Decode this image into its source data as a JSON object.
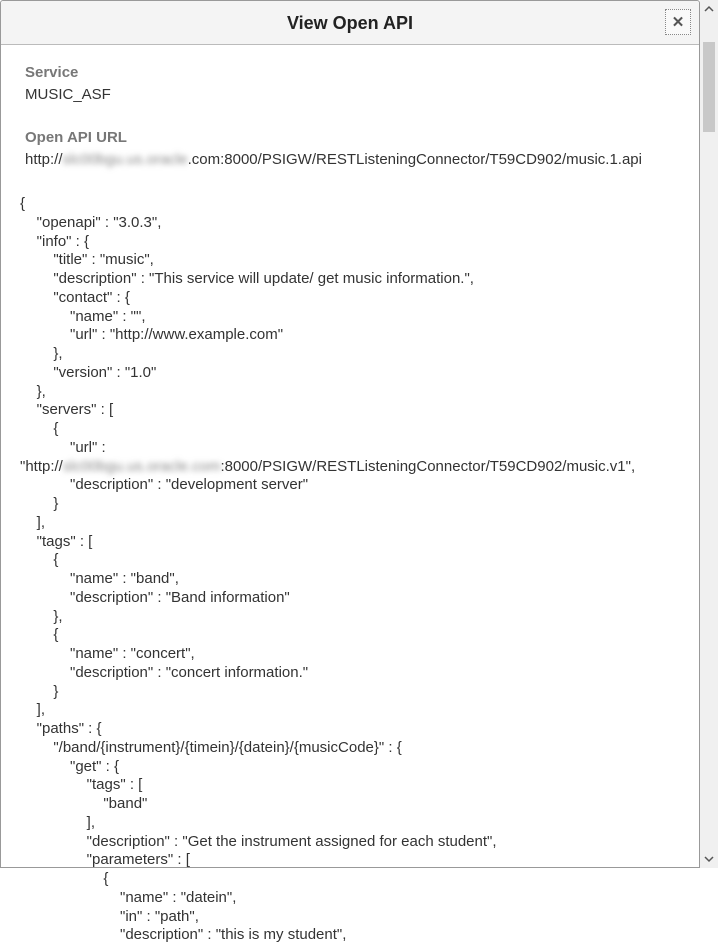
{
  "header": {
    "title": "View Open API",
    "close_glyph": "✕"
  },
  "labels": {
    "service": "Service",
    "service_value": "MUSIC_ASF",
    "openapi_url": "Open API URL",
    "url_prefix": "http://",
    "url_blurred": "slc00bgu.us.oracle",
    "url_suffix": ".com:8000/PSIGW/RESTListeningConnector/T59CD902/music.1.api"
  },
  "json_lines": {
    "l01": "{",
    "l02": "    \"openapi\" : \"3.0.3\",",
    "l03": "    \"info\" : {",
    "l04": "        \"title\" : \"music\",",
    "l05": "        \"description\" : \"This service will update/ get music information.\",",
    "l06": "        \"contact\" : {",
    "l07": "            \"name\" : \"\",",
    "l08": "            \"url\" : \"http://www.example.com\"",
    "l09": "        },",
    "l10": "        \"version\" : \"1.0\"",
    "l11": "    },",
    "l12": "    \"servers\" : [",
    "l13": "        {",
    "l14": "            \"url\" :",
    "l15a": "\"http://",
    "l15b": "slc00bgu.us.oracle.com",
    "l15c": ":8000/PSIGW/RESTListeningConnector/T59CD902/music.v1\",",
    "l16": "            \"description\" : \"development server\"",
    "l17": "        }",
    "l18": "    ],",
    "l19": "    \"tags\" : [",
    "l20": "        {",
    "l21": "            \"name\" : \"band\",",
    "l22": "            \"description\" : \"Band information\"",
    "l23": "        },",
    "l24": "        {",
    "l25": "            \"name\" : \"concert\",",
    "l26": "            \"description\" : \"concert information.\"",
    "l27": "        }",
    "l28": "    ],",
    "l29": "    \"paths\" : {",
    "l30": "        \"/band/{instrument}/{timein}/{datein}/{musicCode}\" : {",
    "l31": "            \"get\" : {",
    "l32": "                \"tags\" : [",
    "l33": "                    \"band\"",
    "l34": "                ],",
    "l35": "                \"description\" : \"Get the instrument assigned for each student\",",
    "l36": "                \"parameters\" : [",
    "l37": "                    {",
    "l38": "                        \"name\" : \"datein\",",
    "l39": "                        \"in\" : \"path\",",
    "l40": "                        \"description\" : \"this is my student\","
  }
}
